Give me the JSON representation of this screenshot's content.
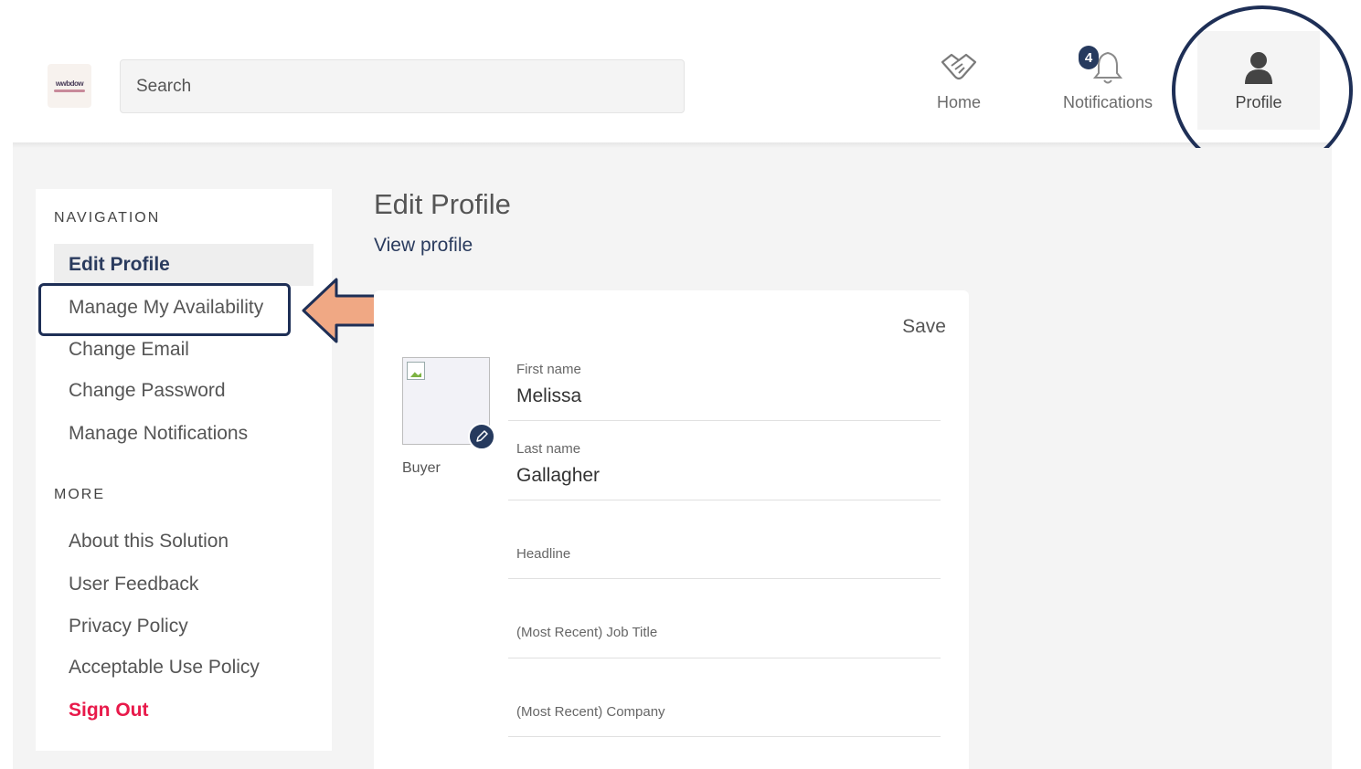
{
  "header": {
    "logo_text": "wwbdow",
    "search_placeholder": "Search",
    "nav": {
      "home_label": "Home",
      "notifications_label": "Notifications",
      "notifications_count": "4",
      "profile_label": "Profile"
    }
  },
  "sidebar": {
    "navigation_title": "NAVIGATION",
    "navigation_items": [
      "Edit Profile",
      "Manage My Availability",
      "Change Email",
      "Change Password",
      "Manage Notifications"
    ],
    "more_title": "MORE",
    "more_items": [
      "About this Solution",
      "User Feedback",
      "Privacy Policy",
      "Acceptable Use Policy"
    ],
    "sign_out": "Sign Out"
  },
  "main": {
    "title": "Edit Profile",
    "view_profile": "View profile",
    "save_label": "Save",
    "role": "Buyer",
    "fields": {
      "first_name_label": "First name",
      "first_name_value": "Melissa",
      "last_name_label": "Last name",
      "last_name_value": "Gallagher",
      "headline_label": "Headline",
      "job_title_label": "(Most Recent) Job Title",
      "company_label": "(Most Recent) Company"
    }
  },
  "colors": {
    "accent_navy": "#263a5e",
    "sign_out_red": "#e8194a",
    "annotation_arrow": "#f0a884"
  }
}
